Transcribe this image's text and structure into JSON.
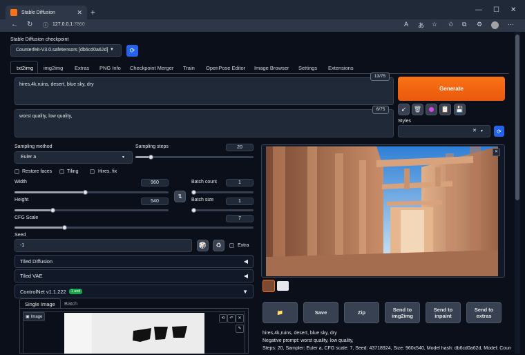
{
  "browser": {
    "tab_title": "Stable Diffusion",
    "tab_close": "✕",
    "new_tab": "+",
    "url_host": "127.0.0.1",
    "url_port": ":7860",
    "minimize": "—",
    "maximize": "☐",
    "close": "✕"
  },
  "checkpoint": {
    "label": "Stable Diffusion checkpoint",
    "value": "Counterfeit-V3.0.safetensors [db6cd0a62d]"
  },
  "tabs": [
    "txt2img",
    "img2img",
    "Extras",
    "PNG Info",
    "Checkpoint Merger",
    "Train",
    "OpenPose Editor",
    "Image Browser",
    "Settings",
    "Extensions"
  ],
  "prompt": {
    "positive": "hires,4k,ruins, desert, blue sky, dry",
    "positive_count": "13/75",
    "negative": "worst quality, low quality,",
    "negative_count": "6/75"
  },
  "generate_label": "Generate",
  "styles_label": "Styles",
  "sampling": {
    "method_label": "Sampling method",
    "method_value": "Euler a",
    "steps_label": "Sampling steps",
    "steps_value": "20",
    "steps_fraction": 0.13
  },
  "checkboxes": {
    "restore_faces": "Restore faces",
    "tiling": "Tiling",
    "hires_fix": "Hires. fix"
  },
  "width": {
    "label": "Width",
    "value": "960",
    "fraction": 0.46
  },
  "height": {
    "label": "Height",
    "value": "540",
    "fraction": 0.25
  },
  "batch_count": {
    "label": "Batch count",
    "value": "1",
    "fraction": 0.0
  },
  "batch_size": {
    "label": "Batch size",
    "value": "1",
    "fraction": 0.0
  },
  "cfg": {
    "label": "CFG Scale",
    "value": "7",
    "fraction": 0.21
  },
  "seed": {
    "label": "Seed",
    "value": "-1",
    "extra_label": "Extra"
  },
  "accordions": {
    "tiled_diffusion": "Tiled Diffusion",
    "tiled_vae": "Tiled VAE"
  },
  "controlnet": {
    "title": "ControlNet v1.1.222",
    "badge": "1 unit",
    "tab_single": "Single Image",
    "tab_batch": "Batch",
    "image_label": "Image"
  },
  "output_buttons": {
    "folder": "📁",
    "save": "Save",
    "zip": "Zip",
    "send_img2img": "Send to img2img",
    "send_inpaint": "Send to inpaint",
    "send_extras": "Send to extras"
  },
  "info": {
    "line1": "hires,4k,ruins, desert, blue sky, dry",
    "line2": "Negative prompt: worst quality, low quality,",
    "line3": "Steps: 20, Sampler: Euler a, CFG scale: 7, Seed: 43718924, Size: 960x540, Model hash: db6cd0a62d, Model: Counterfeit-V3.0"
  },
  "colors": {
    "accent": "#f97316",
    "background": "#0b0f19",
    "panel": "#1f2937",
    "badge": "#16a34a"
  }
}
